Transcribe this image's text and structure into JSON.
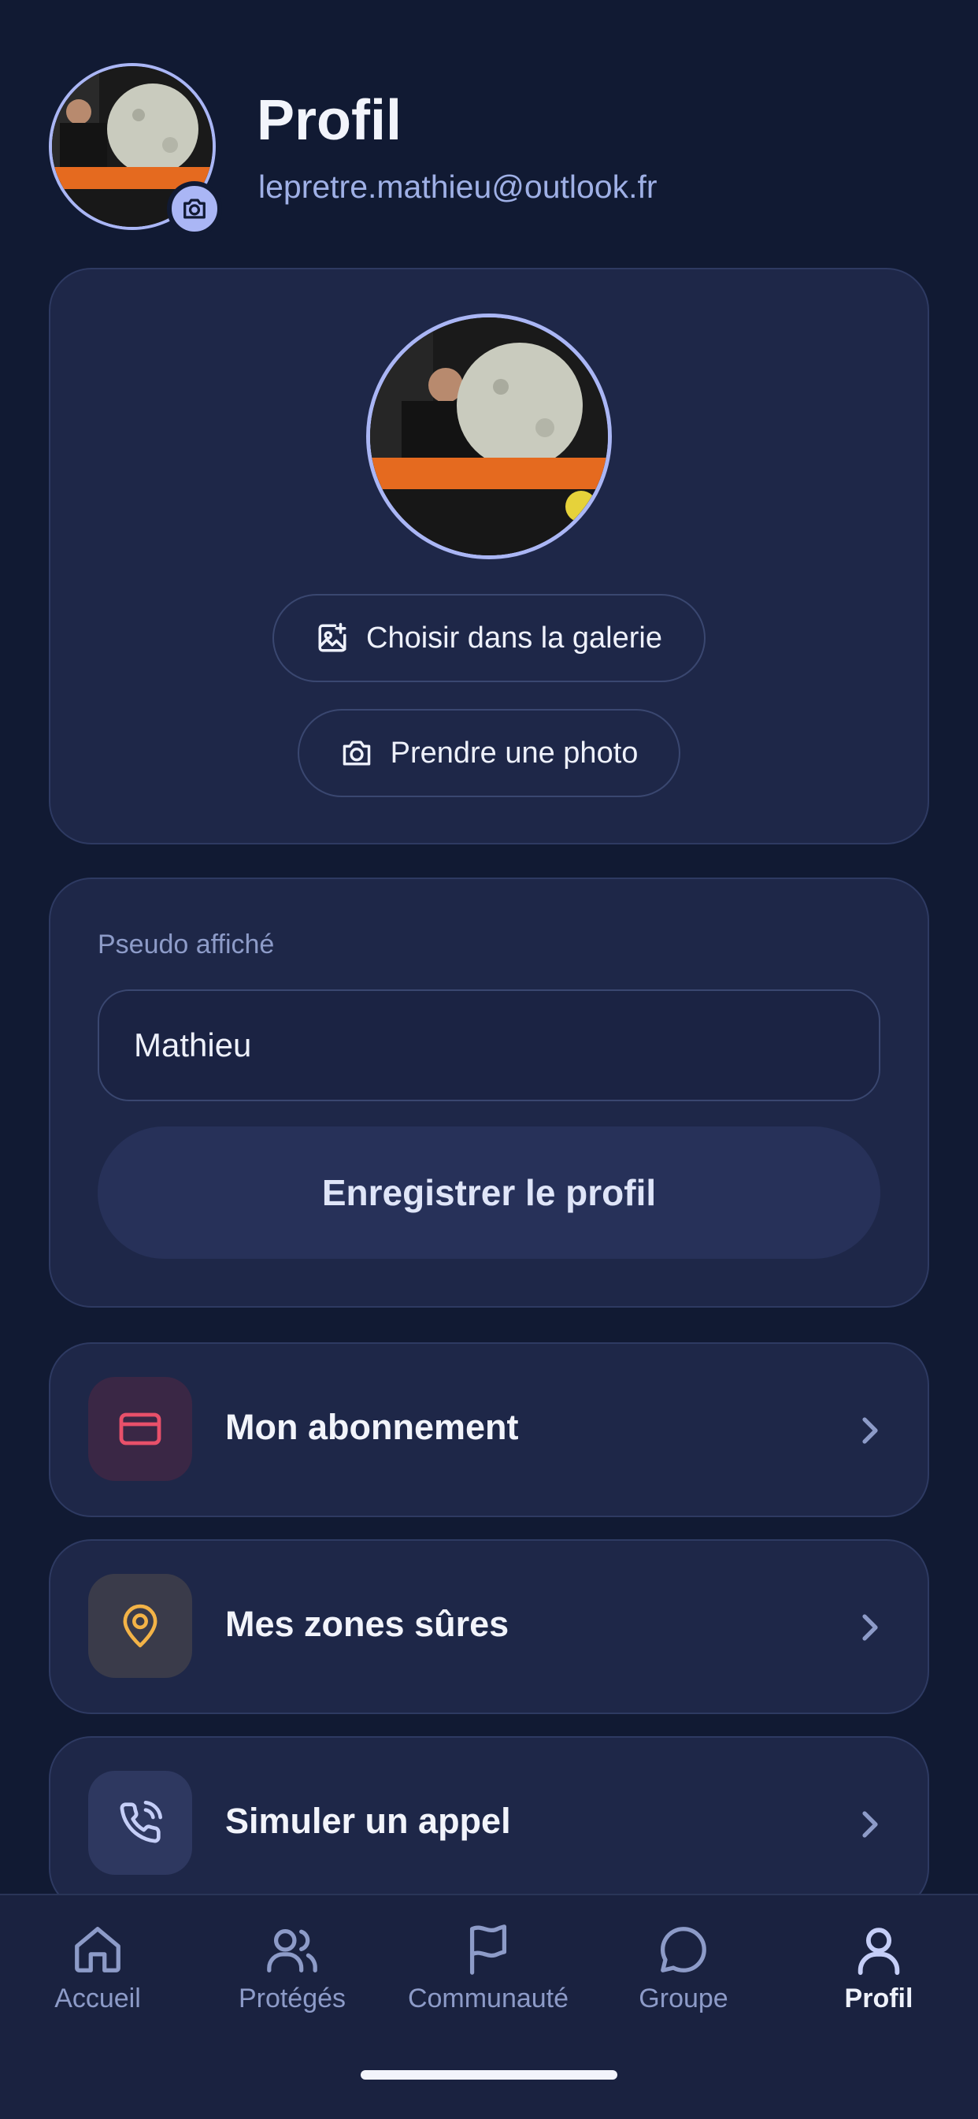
{
  "header": {
    "title": "Profil",
    "email": "lepretre.mathieu@outlook.fr"
  },
  "photo_card": {
    "gallery_label": "Choisir dans la galerie",
    "camera_label": "Prendre une photo"
  },
  "profile_form": {
    "nickname_label": "Pseudo affiché",
    "nickname_value": "Mathieu",
    "save_label": "Enregistrer le profil"
  },
  "menu": [
    {
      "label": "Mon abonnement",
      "icon": "credit-card-icon",
      "icon_color": "#e8506a",
      "icon_bg": "#3a2745"
    },
    {
      "label": "Mes zones sûres",
      "icon": "map-pin-icon",
      "icon_color": "#f3b347",
      "icon_bg": "#3a3b4a"
    },
    {
      "label": "Simuler un appel",
      "icon": "phone-call-icon",
      "icon_color": "#c5cef7",
      "icon_bg": "#2e3860"
    }
  ],
  "nav": [
    {
      "label": "Accueil",
      "icon": "home-icon",
      "active": false
    },
    {
      "label": "Protégés",
      "icon": "users-icon",
      "active": false
    },
    {
      "label": "Communauté",
      "icon": "flag-icon",
      "active": false
    },
    {
      "label": "Groupe",
      "icon": "chat-bubble-icon",
      "active": false
    },
    {
      "label": "Profil",
      "icon": "user-icon",
      "active": true
    }
  ],
  "colors": {
    "background": "#111a33",
    "card": "#1e2748",
    "accent": "#aab6f5"
  }
}
